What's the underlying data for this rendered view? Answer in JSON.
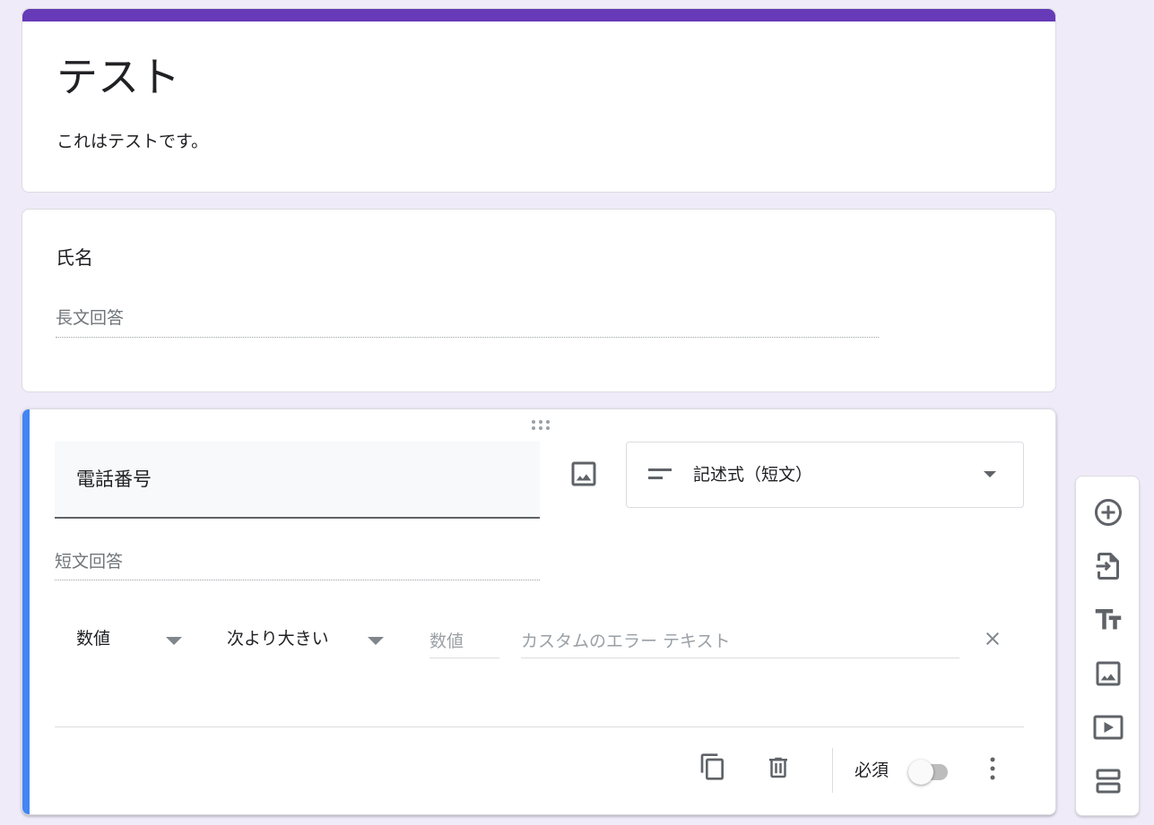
{
  "form": {
    "title": "テスト",
    "description": "これはテストです。",
    "accent_color": "#673ab7",
    "background_color": "#f0ebf8"
  },
  "questions": [
    {
      "title": "氏名",
      "answer_placeholder": "長文回答"
    },
    {
      "title": "電話番号",
      "type_label": "記述式（短文）",
      "type_icon": "short-answer-icon",
      "answer_placeholder": "短文回答",
      "validation": {
        "type": "数値",
        "condition": "次より大きい",
        "value_placeholder": "数値",
        "error_placeholder": "カスタムのエラー テキスト"
      },
      "required_label": "必須",
      "required": false,
      "active_color": "#4285f4"
    }
  ],
  "toolbar": {
    "icons": [
      "add-question-icon",
      "import-questions-icon",
      "add-title-icon",
      "add-image-icon",
      "add-video-icon",
      "add-section-icon"
    ]
  }
}
